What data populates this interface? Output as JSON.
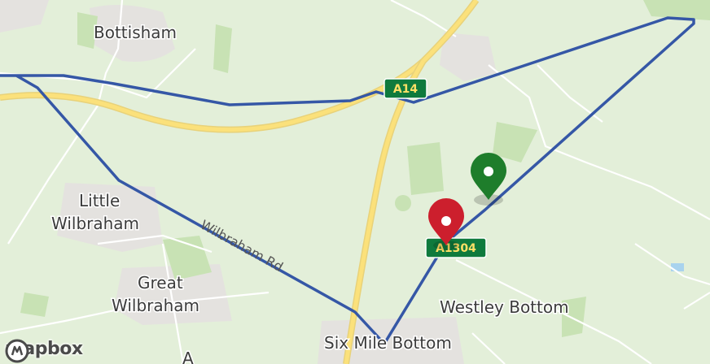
{
  "map": {
    "places": [
      {
        "id": "bottisham",
        "name": "Bottisham"
      },
      {
        "id": "little-wilbraham-1",
        "name": "Little"
      },
      {
        "id": "little-wilbraham-2",
        "name": "Wilbraham"
      },
      {
        "id": "great-wilbraham-1",
        "name": "Great"
      },
      {
        "id": "great-wilbraham-2",
        "name": "Wilbraham"
      },
      {
        "id": "westley-bottom",
        "name": "Westley Bottom"
      },
      {
        "id": "six-mile-bottom",
        "name": "Six Mile Bottom"
      }
    ],
    "roads": {
      "a14_label": "A14",
      "a1304_label": "A1304",
      "wilbraham_rd_label": "Wilbraham Rd"
    },
    "markers": [
      {
        "id": "start",
        "color": "#1e7d2b",
        "icon": "map-pin-icon"
      },
      {
        "id": "end",
        "color": "#cc1f2d",
        "icon": "map-pin-icon"
      }
    ],
    "route_color": "#3557a6",
    "attribution": {
      "logo_text": "mapbox"
    }
  }
}
